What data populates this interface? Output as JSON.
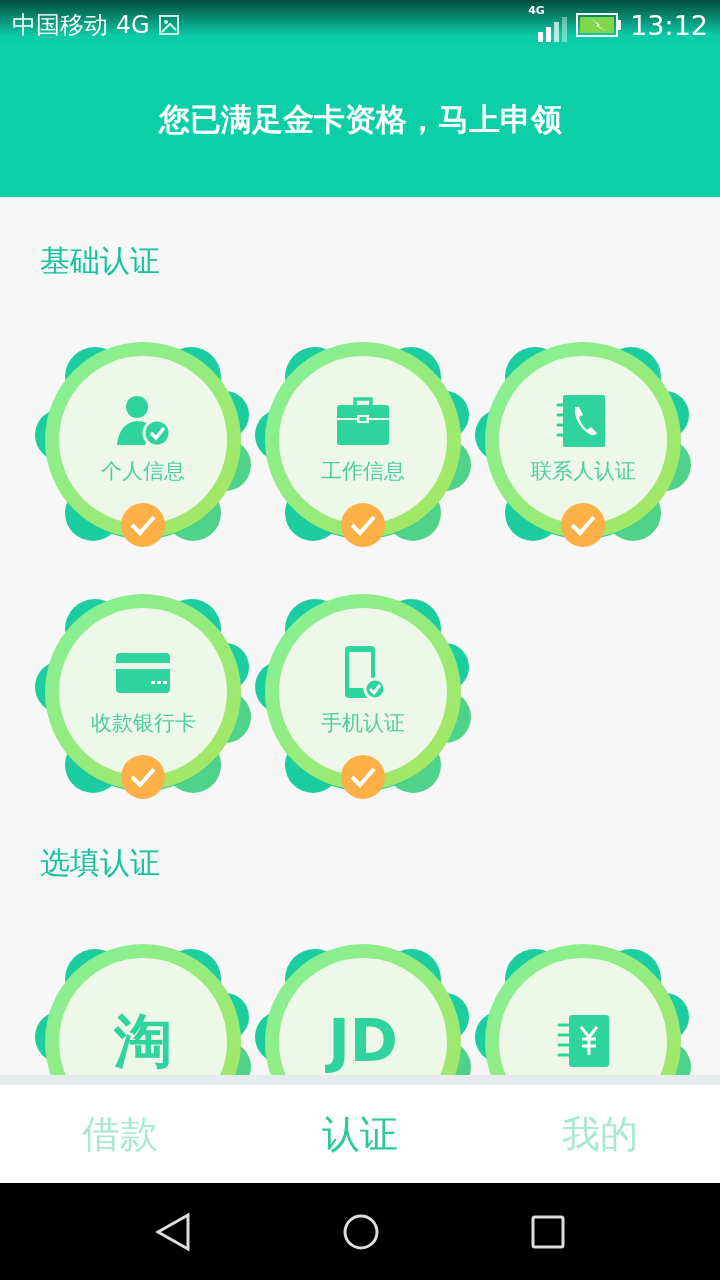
{
  "status_bar": {
    "carrier": "中国移动 4G",
    "network": "4G",
    "time": "13:12"
  },
  "header": {
    "title": "您已满足金卡资格，马上申领"
  },
  "sections": [
    {
      "title": "基础认证",
      "items": [
        {
          "kind": "icon",
          "label": "个人信息",
          "done": true
        },
        {
          "kind": "icon",
          "label": "工作信息",
          "done": true
        },
        {
          "kind": "icon",
          "label": "联系人认证",
          "done": true
        },
        {
          "kind": "icon",
          "label": "收款银行卡",
          "done": true
        },
        {
          "kind": "icon",
          "label": "手机认证",
          "done": true
        }
      ]
    },
    {
      "title": "选填认证",
      "items": [
        {
          "kind": "logo",
          "logo": "淘"
        },
        {
          "kind": "logo",
          "logo": "JD"
        },
        {
          "kind": "icon"
        }
      ]
    }
  ],
  "tabs": [
    {
      "label": "借款",
      "selected": false
    },
    {
      "label": "认证",
      "selected": true
    },
    {
      "label": "我的",
      "selected": false
    }
  ]
}
